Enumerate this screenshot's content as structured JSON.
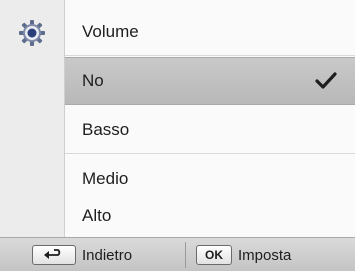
{
  "menu": {
    "title": "Volume",
    "items": [
      {
        "label": "No",
        "selected": true
      },
      {
        "label": "Basso",
        "selected": false
      },
      {
        "label": "Medio",
        "selected": false
      },
      {
        "label": "Alto",
        "selected": false
      }
    ]
  },
  "bottom_bar": {
    "back_label": "Indietro",
    "ok_key_label": "OK",
    "ok_label": "Imposta"
  },
  "icons": {
    "settings": "gear-icon",
    "selected_mark": "checkmark-icon",
    "back_key": "return-arrow-icon"
  },
  "colors": {
    "selected_row": "#bfbfbf",
    "gutter": "#ececec",
    "settings_icon_accent": "#2b3f7a"
  }
}
